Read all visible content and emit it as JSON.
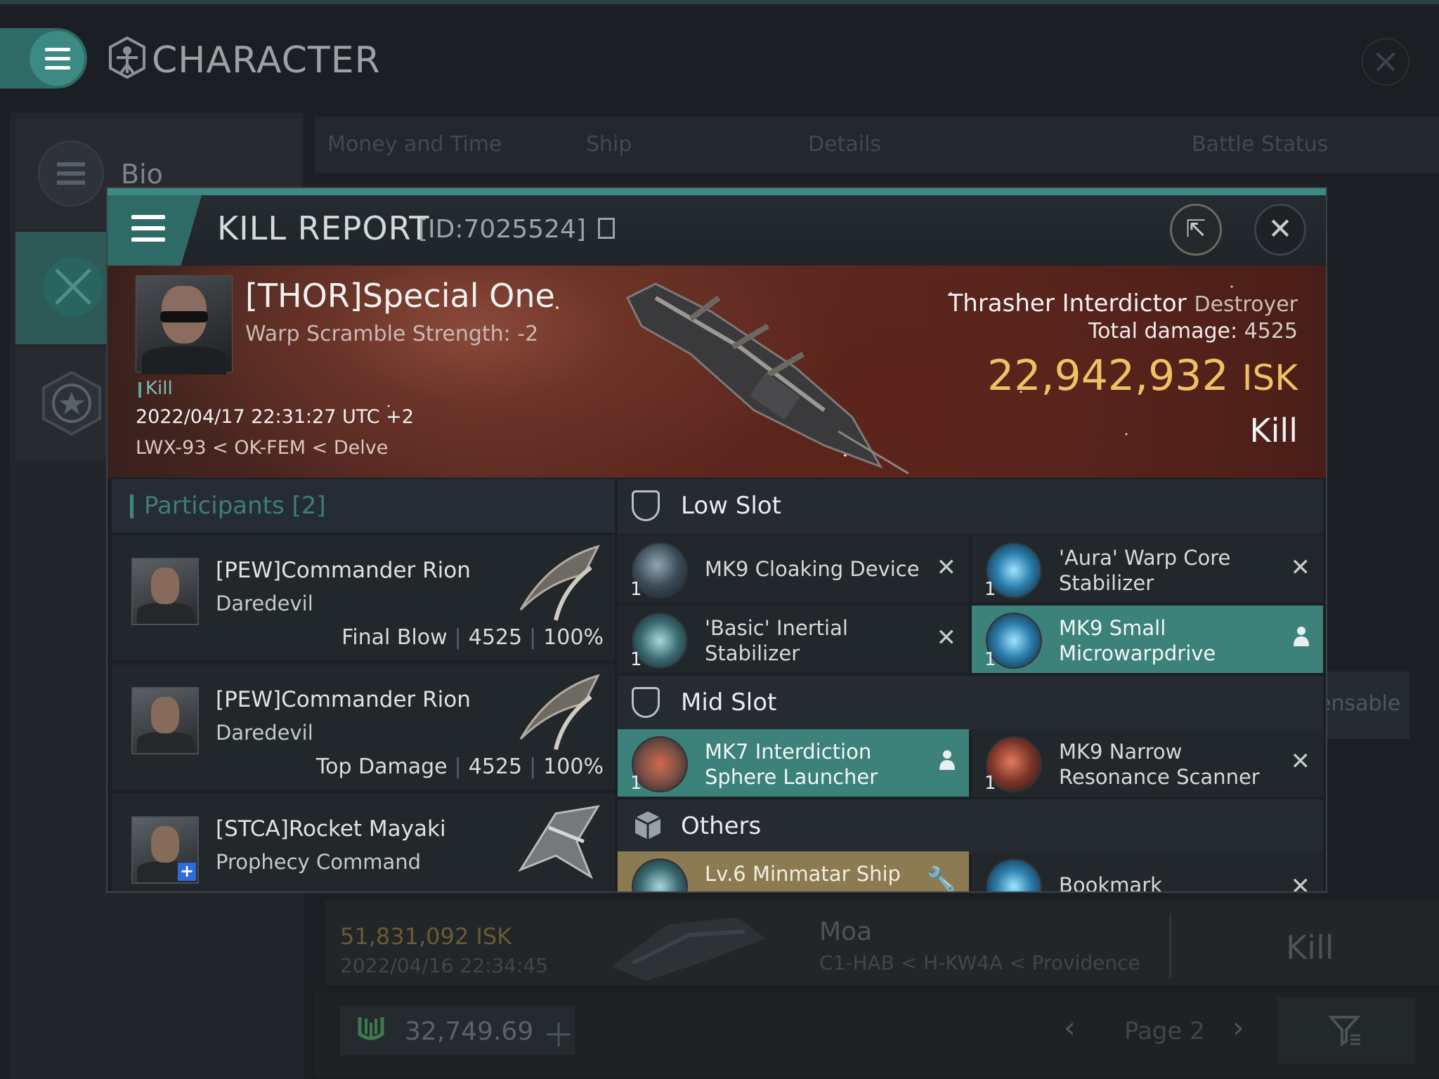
{
  "topbar": {
    "title": "CHARACTER"
  },
  "sidebar": {
    "items": [
      {
        "label": "Bio"
      }
    ]
  },
  "background": {
    "tabs": [
      "Money and Time",
      "Ship",
      "Details",
      "Battle Status"
    ],
    "row": {
      "isk": "51,831,092 ISK",
      "date": "2022/04/16  22:34:45",
      "ship": "Moa",
      "location": "C1-HAB < H-KW4A < Providence",
      "result": "Kill"
    },
    "side_label": "ensable",
    "footer": {
      "balance": "32,749.69",
      "page": "Page 2"
    }
  },
  "kill_report": {
    "title": "KILL REPORT",
    "id": "[ID:7025524]",
    "victim": {
      "name": "[THOR]Special One",
      "warp_scramble": "Warp Scramble Strength: -2",
      "tag": "Kill",
      "datetime": "2022/04/17 22:31:27 UTC +2",
      "location": "LWX-93 < OK-FEM < Delve"
    },
    "ship": {
      "name": "Thrasher Interdictor",
      "class": "Destroyer",
      "total_damage_label": "Total damage:",
      "total_damage": "4525",
      "isk_value": "22,942,932",
      "isk_unit": "ISK",
      "result": "Kill"
    },
    "participants": {
      "header": "Participants [2]",
      "rows": [
        {
          "name": "[PEW]Commander Rion",
          "ship": "Daredevil",
          "role": "Final Blow",
          "damage": "4525",
          "percent": "100%"
        },
        {
          "name": "[PEW]Commander Rion",
          "ship": "Daredevil",
          "role": "Top Damage",
          "damage": "4525",
          "percent": "100%"
        },
        {
          "name": "[STCA]Rocket Mayaki",
          "ship": "Prophecy Command"
        }
      ]
    },
    "fittings": {
      "low_slot": {
        "label": "Low Slot",
        "items": [
          {
            "name": "MK9 Cloaking Device",
            "qty": "1",
            "action": "✕"
          },
          {
            "name": "'Aura' Warp Core Stabilizer",
            "qty": "1",
            "action": "✕"
          },
          {
            "name": "'Basic' Inertial Stabilizer",
            "qty": "1",
            "action": "✕"
          },
          {
            "name": "MK9 Small Microwarpdrive",
            "qty": "1",
            "action": "user-icon"
          }
        ]
      },
      "mid_slot": {
        "label": "Mid Slot",
        "items": [
          {
            "name": "MK7 Interdiction Sphere Launcher",
            "qty": "1",
            "action": "user-icon"
          },
          {
            "name": "MK9 Narrow Resonance Scanner",
            "qty": "1",
            "action": "✕"
          }
        ]
      },
      "others": {
        "label": "Others",
        "items": [
          {
            "name": "Lv.6 Minmatar Ship",
            "action": "wrench-icon"
          },
          {
            "name": "Bookmark",
            "action": "✕"
          }
        ]
      }
    }
  },
  "colors": {
    "accent": "#3d8a84",
    "isk_gold": "#f0c164",
    "highlight_teal": "#3d817b",
    "highlight_gold": "#8c7b52"
  }
}
